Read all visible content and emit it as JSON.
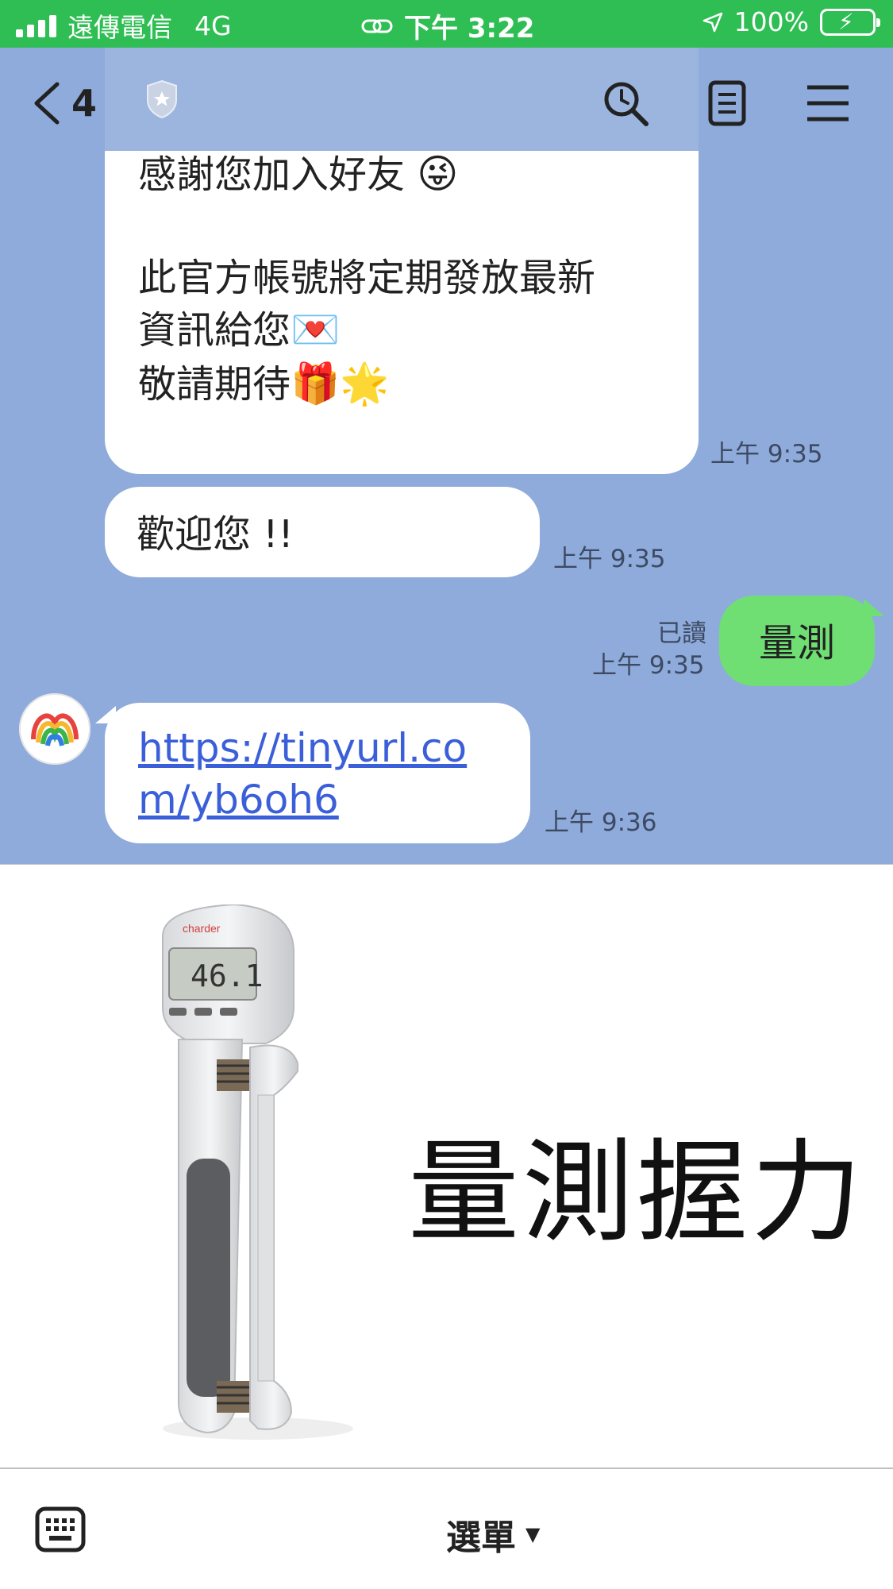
{
  "status_bar": {
    "carrier": "遠傳電信",
    "network": "4G",
    "time": "下午 3:22",
    "battery": "100%"
  },
  "header": {
    "back_count": "4"
  },
  "messages": {
    "welcome_text": {
      "line1": "感謝您加入好友",
      "line2": "此官方帳號將定期發放最新",
      "line3": "資訊給您",
      "line4": "敬請期待",
      "time": "上午 9:35"
    },
    "greeting": {
      "text": "歡迎您 !!",
      "time": "上午 9:35"
    },
    "user_message": {
      "text": "量測",
      "read_status": "已讀",
      "time": "上午 9:35"
    },
    "link_message": {
      "url": "https://tinyurl.com/yb6oh6",
      "time": "上午 9:36"
    }
  },
  "rich_menu": {
    "title": "量測握力",
    "device_brand": "charder",
    "device_reading": "46.1"
  },
  "bottom_bar": {
    "menu_label": "選單",
    "caret": "▼"
  },
  "icons": {
    "back": "chevron-left-icon",
    "search": "search-icon",
    "notes": "note-icon",
    "menu": "hamburger-icon",
    "keyboard": "keyboard-icon"
  },
  "colors": {
    "status_bar": "#2fbe53",
    "chat_background": "#8fabdb",
    "own_bubble": "#6fdf74",
    "link": "#3b5fd8"
  }
}
